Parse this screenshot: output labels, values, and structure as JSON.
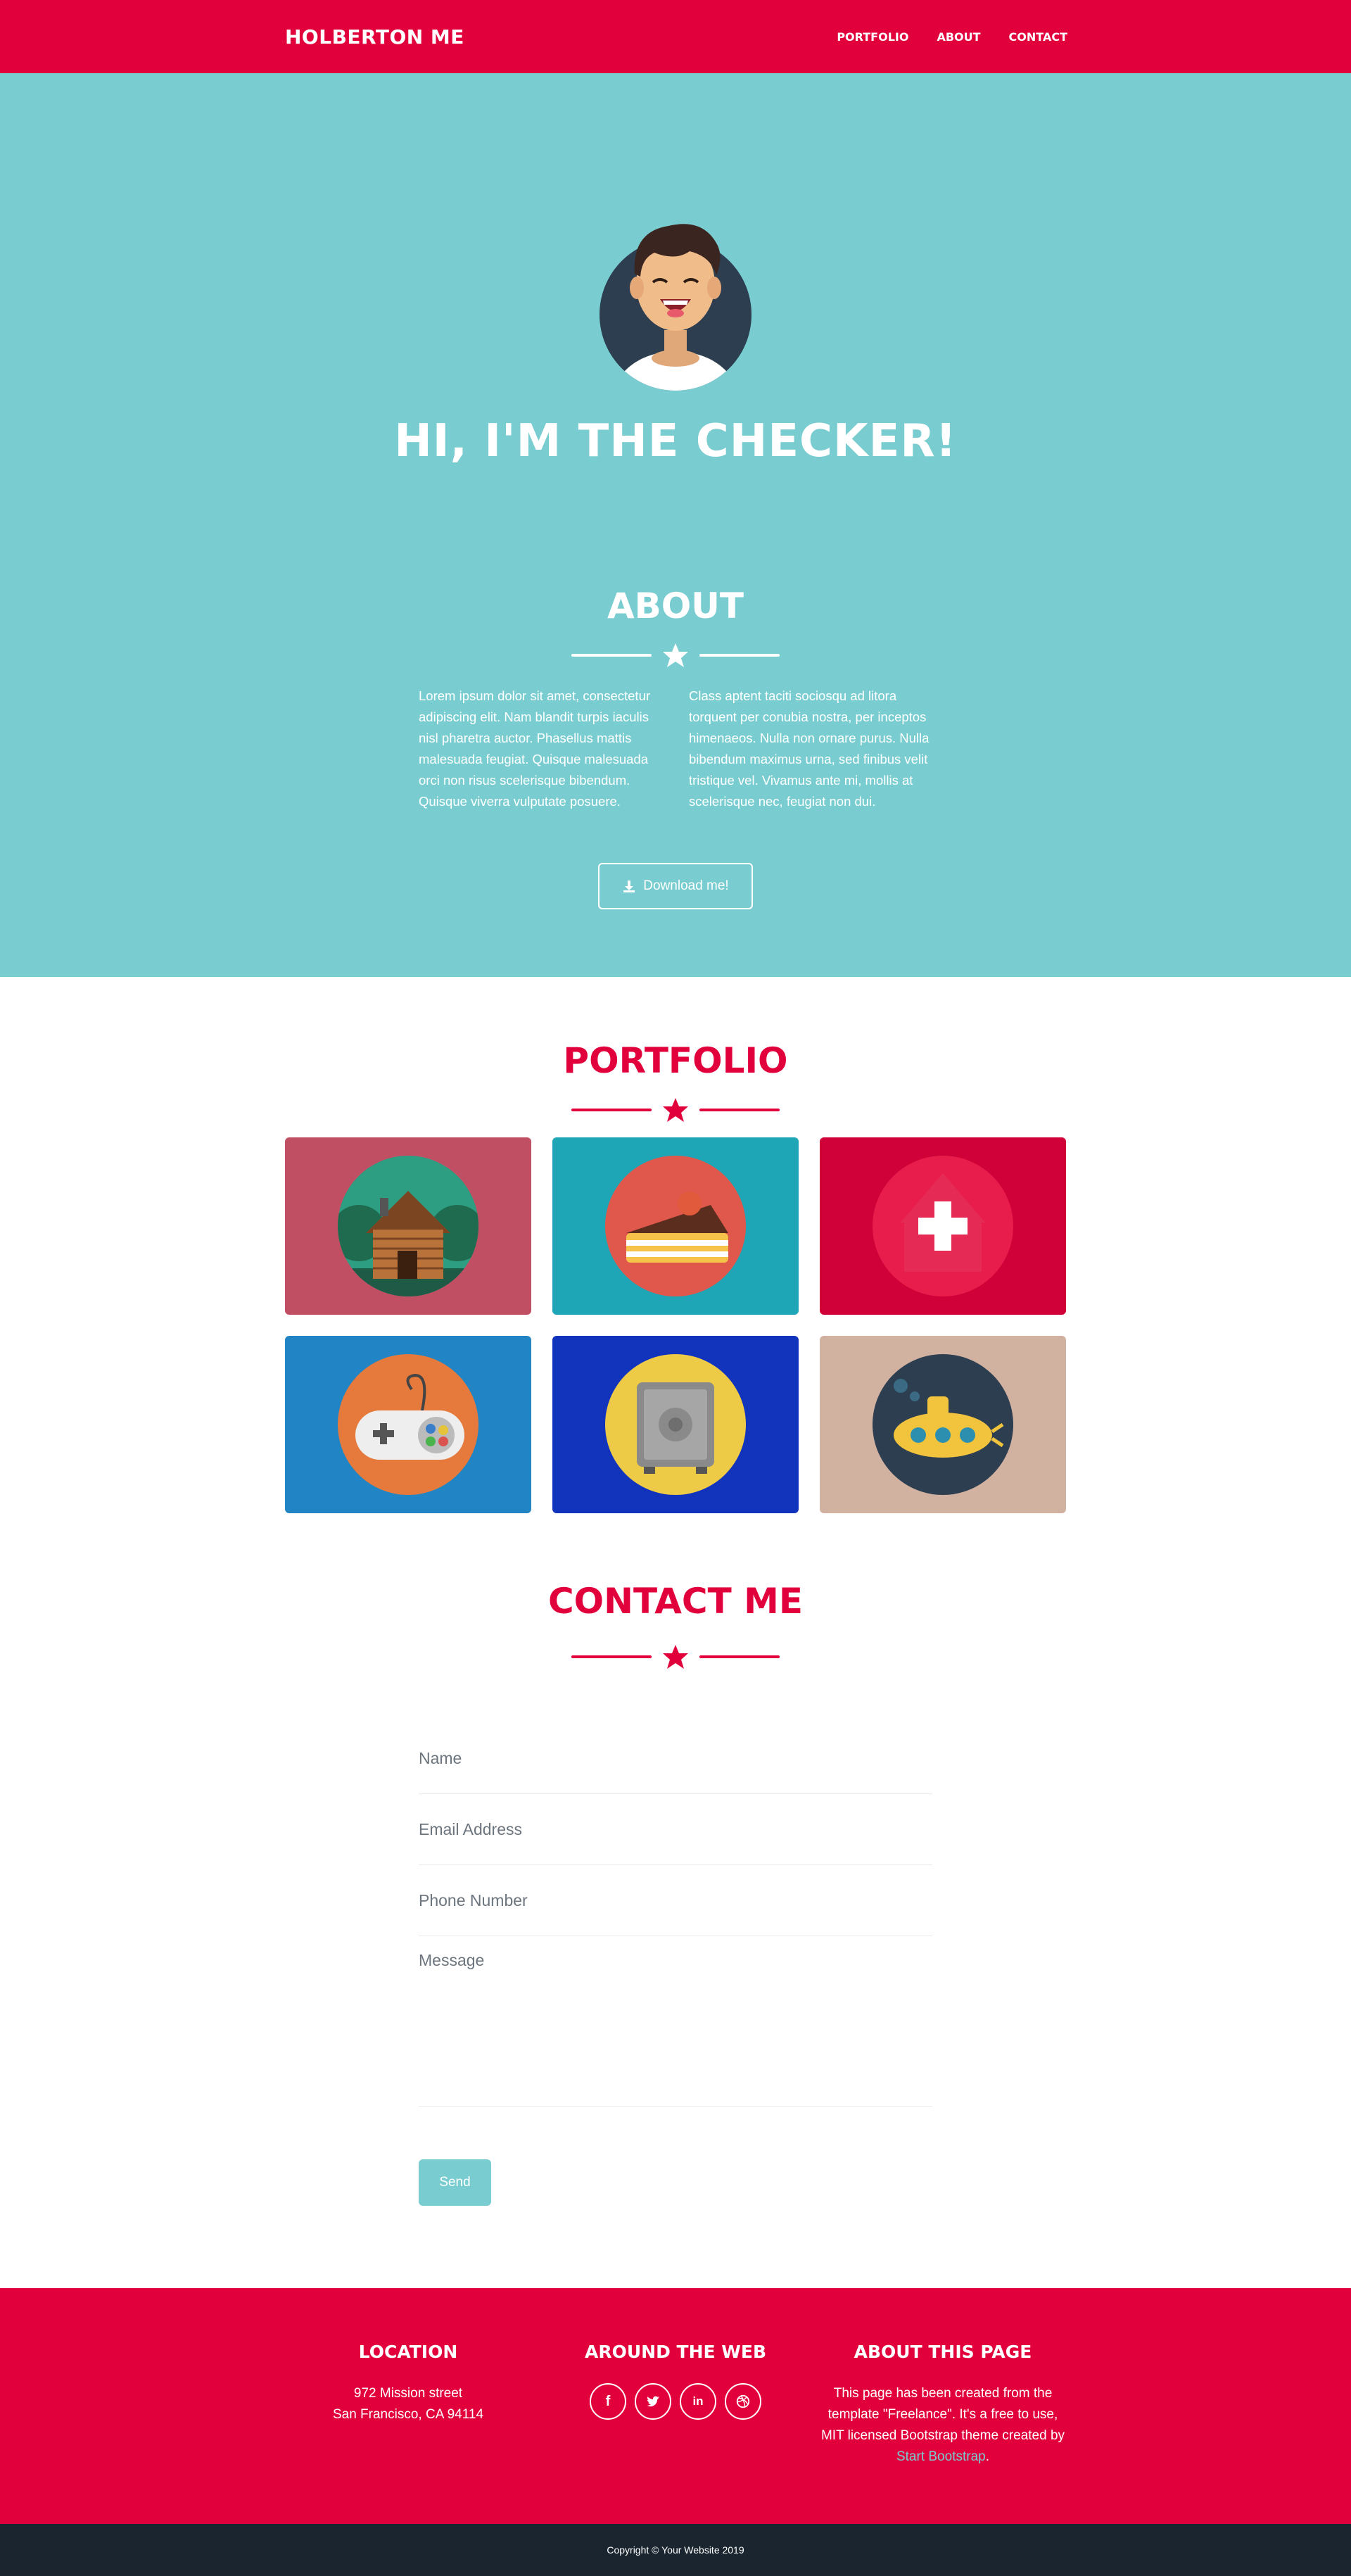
{
  "colors": {
    "primary": "#e1003c",
    "teal": "#79cdd0",
    "dark": "#1a252f"
  },
  "nav": {
    "brand": "HOLBERTON ME",
    "links": [
      "PORTFOLIO",
      "ABOUT",
      "CONTACT"
    ]
  },
  "masthead": {
    "title": "HI, I'M THE CHECKER!",
    "avatar_icon": "smiling-man-avatar"
  },
  "about": {
    "title": "ABOUT",
    "col1": "Lorem ipsum dolor sit amet, consectetur adipiscing elit. Nam blandit turpis iaculis nisl pharetra auctor. Phasellus mattis malesuada feugiat. Quisque malesuada orci non risus scelerisque bibendum. Quisque viverra vulputate posuere.",
    "col2": "Class aptent taciti sociosqu ad litora torquent per conubia nostra, per inceptos himenaeos. Nulla non ornare purus. Nulla bibendum maximus urna, sed finibus velit tristique vel. Vivamus ante mi, mollis at scelerisque nec, feugiat non dui.",
    "button": "Download me!"
  },
  "portfolio": {
    "title": "PORTFOLIO",
    "items": [
      {
        "icon": "cabin-icon",
        "bg": "#c14f63"
      },
      {
        "icon": "cake-icon",
        "bg": "#1ea5b6"
      },
      {
        "icon": "circus-tent-icon",
        "bg": "#d00038"
      },
      {
        "icon": "game-controller-icon",
        "bg": "#2185c5"
      },
      {
        "icon": "safe-icon",
        "bg": "#1234bc"
      },
      {
        "icon": "submarine-icon",
        "bg": "#d1b2a1"
      }
    ]
  },
  "contact": {
    "title": "CONTACT ME",
    "name_placeholder": "Name",
    "email_placeholder": "Email Address",
    "phone_placeholder": "Phone Number",
    "message_placeholder": "Message",
    "send": "Send"
  },
  "footer": {
    "location_title": "LOCATION",
    "location_line1": "972 Mission street",
    "location_line2": "San Francisco, CA 94114",
    "web_title": "AROUND THE WEB",
    "social": [
      "facebook-icon",
      "twitter-icon",
      "linkedin-icon",
      "dribbble-icon"
    ],
    "about_title": "ABOUT THIS PAGE",
    "about_text": "This page has been created from the template \"Freelance\". It's a free to use, MIT licensed Bootstrap theme created by",
    "about_link": "Start Bootstrap",
    "about_end": "."
  },
  "copyright": "Copyright © Your Website 2019"
}
